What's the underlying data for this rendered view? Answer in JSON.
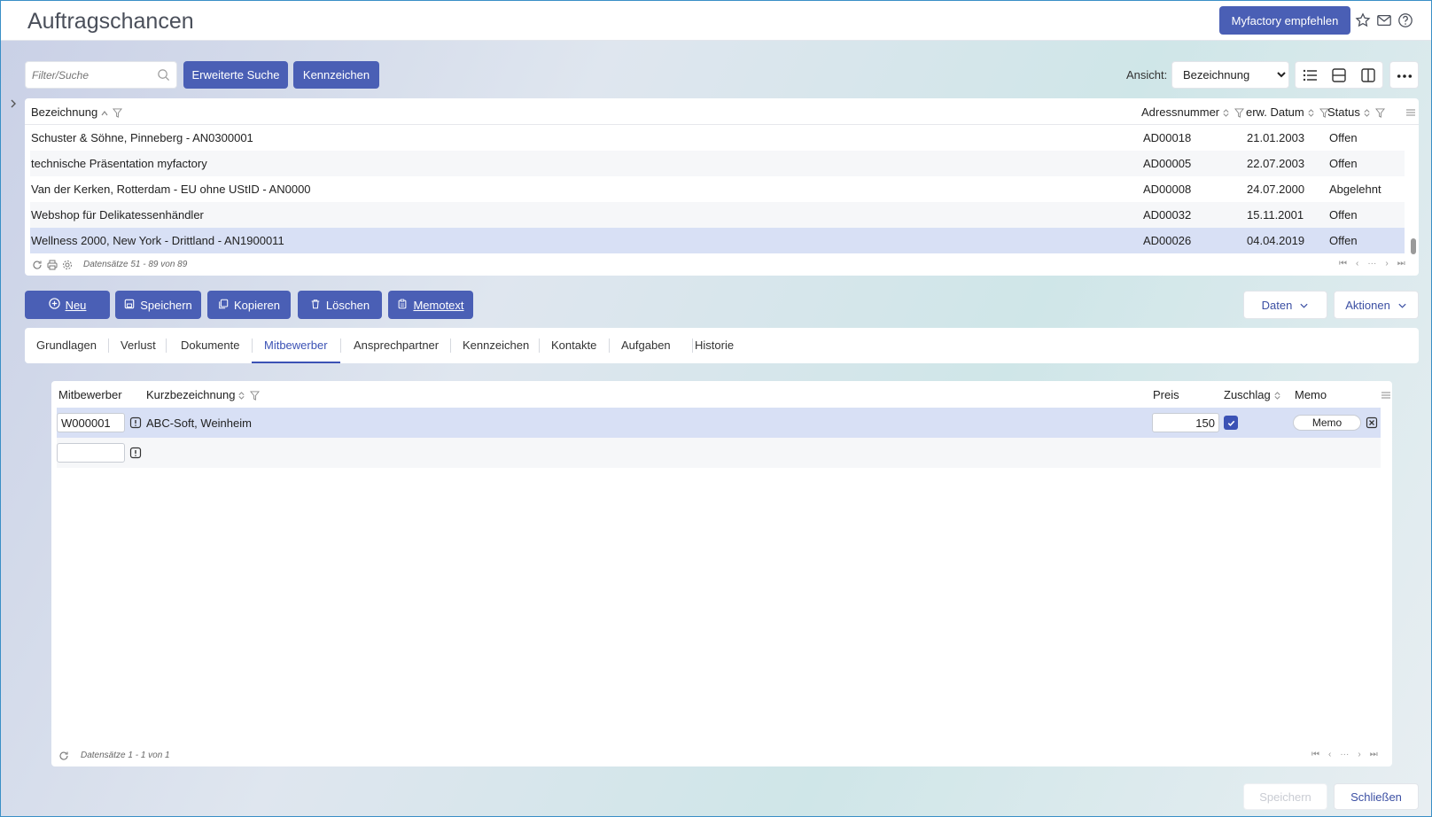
{
  "app": {
    "title": "Auftragschancen",
    "recommend_label": "Myfactory empfehlen"
  },
  "toolbar": {
    "search_placeholder": "Filter/Suche",
    "advanced_search_label": "Erweiterte Suche",
    "kennzeichen_label": "Kennzeichen",
    "view_label": "Ansicht:",
    "view_selected": "Bezeichnung"
  },
  "grid": {
    "columns": [
      "Bezeichnung",
      "Adressnummer",
      "erw. Datum",
      "Status"
    ],
    "rows": [
      {
        "bezeichnung": "Schuster & Söhne, Pinneberg - AN0300001",
        "adresse": "AD00018",
        "datum": "21.01.2003",
        "status": "Offen"
      },
      {
        "bezeichnung": "technische Präsentation myfactory",
        "adresse": "AD00005",
        "datum": "22.07.2003",
        "status": "Offen"
      },
      {
        "bezeichnung": "Van der Kerken, Rotterdam - EU ohne UStID - AN0000",
        "adresse": "AD00008",
        "datum": "24.07.2000",
        "status": "Abgelehnt"
      },
      {
        "bezeichnung": "Webshop für Delikatessenhändler",
        "adresse": "AD00032",
        "datum": "15.11.2001",
        "status": "Offen"
      },
      {
        "bezeichnung": "Wellness 2000, New York - Drittland - AN1900011",
        "adresse": "AD00026",
        "datum": "04.04.2019",
        "status": "Offen"
      }
    ],
    "footer": "Datensätze 51 - 89 von 89"
  },
  "actions": {
    "new": "Neu",
    "save": "Speichern",
    "copy": "Kopieren",
    "delete": "Löschen",
    "memotext": "Memotext",
    "data": "Daten",
    "actions": "Aktionen"
  },
  "tabs": [
    "Grundlagen",
    "Verlust",
    "Dokumente",
    "Mitbewerber",
    "Ansprechpartner",
    "Kennzeichen",
    "Kontakte",
    "Aufgaben",
    "Historie"
  ],
  "active_tab": "Mitbewerber",
  "subgrid": {
    "columns": {
      "mitbewerber": "Mitbewerber",
      "kurz": "Kurzbezeichnung",
      "preis": "Preis",
      "zuschlag": "Zuschlag",
      "memo": "Memo"
    },
    "row": {
      "mitbewerber": "W000001",
      "kurz": "ABC-Soft, Weinheim",
      "preis": "150",
      "memo_label": "Memo"
    },
    "footer": "Datensätze 1 - 1 von 1"
  },
  "bottom": {
    "save": "Speichern",
    "close": "Schließen"
  },
  "colors": {
    "primary": "#4a5fb5",
    "selected_row": "#d8e0f5",
    "active_tab": "#3b52b5"
  }
}
